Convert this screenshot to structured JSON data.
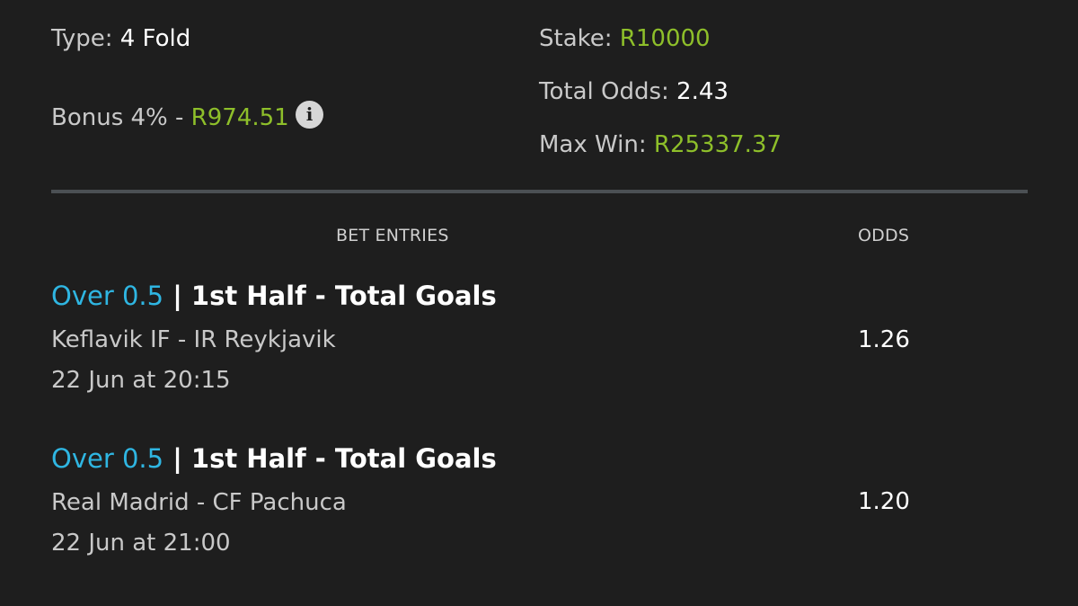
{
  "summary": {
    "type_label": "Type:",
    "type_value": "4 Fold",
    "bonus_label": "Bonus 4% -",
    "bonus_value": "R974.51",
    "info_icon": "info-icon",
    "stake_label": "Stake:",
    "stake_value": "R10000",
    "total_odds_label": "Total Odds:",
    "total_odds_value": "2.43",
    "max_win_label": "Max Win:",
    "max_win_value": "R25337.37"
  },
  "columns": {
    "entries": "BET ENTRIES",
    "odds": "ODDS"
  },
  "entries": [
    {
      "selection": "Over 0.5",
      "separator": "|",
      "market": "1st Half - Total Goals",
      "match": "Keflavik IF - IR Reykjavik",
      "date": "22 Jun at 20:15",
      "odds": "1.26"
    },
    {
      "selection": "Over 0.5",
      "separator": "|",
      "market": "1st Half - Total Goals",
      "match": "Real Madrid - CF Pachuca",
      "date": "22 Jun at 21:00",
      "odds": "1.20"
    }
  ],
  "colors": {
    "background": "#1e1e1e",
    "accent_blue": "#2fb6e2",
    "value_green": "#8ebf2a",
    "divider": "#4b5054"
  }
}
